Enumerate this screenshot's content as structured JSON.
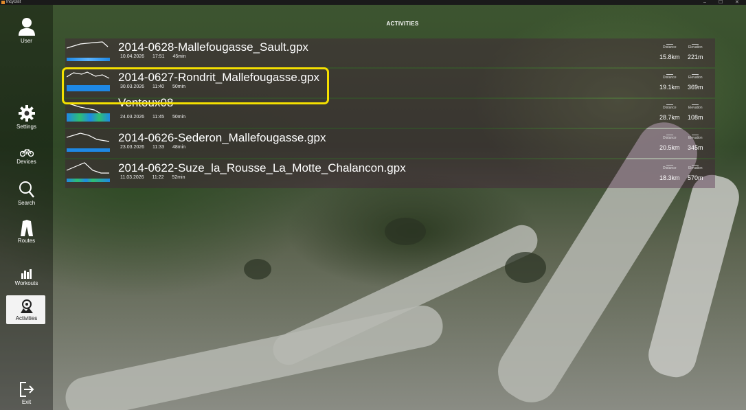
{
  "window": {
    "title": "Incyclist",
    "controls": [
      "–",
      "☐",
      "✕"
    ]
  },
  "header": {
    "title": "ACTIVITIES"
  },
  "sidebar": {
    "items": [
      {
        "label": "User",
        "icon": "user-icon"
      },
      {
        "label": "Settings",
        "icon": "gear-icon"
      },
      {
        "label": "Devices",
        "icon": "bike-icon"
      },
      {
        "label": "Search",
        "icon": "search-icon"
      },
      {
        "label": "Routes",
        "icon": "routes-icon"
      },
      {
        "label": "Workouts",
        "icon": "workouts-icon"
      },
      {
        "label": "Activities",
        "icon": "activities-icon",
        "active": true
      },
      {
        "label": "Exit",
        "icon": "exit-icon"
      }
    ]
  },
  "activities": {
    "distance_label": "Distance",
    "elevation_label": "Elevation",
    "items": [
      {
        "name": "2014-0628-Mallefougasse_Sault.gpx",
        "date": "10.04.2026",
        "time": "17:51",
        "duration": "45min",
        "distance": "15.8km",
        "elevation": "221m"
      },
      {
        "name": "2014-0627-Rondrit_Mallefougasse.gpx",
        "date": "30.03.2026",
        "time": "11:40",
        "duration": "50min",
        "distance": "19.1km",
        "elevation": "369m",
        "highlighted": true
      },
      {
        "name": "Ventoux08",
        "date": "24.03.2026",
        "time": "11:45",
        "duration": "50min",
        "distance": "28.7km",
        "elevation": "108m"
      },
      {
        "name": "2014-0626-Sederon_Mallefougasse.gpx",
        "date": "23.03.2026",
        "time": "11:33",
        "duration": "48min",
        "distance": "20.5km",
        "elevation": "345m"
      },
      {
        "name": "2014-0622-Suze_la_Rousse_La_Motte_Chalancon.gpx",
        "date": "11.03.2026",
        "time": "11:22",
        "duration": "52min",
        "distance": "18.3km",
        "elevation": "570m"
      }
    ]
  },
  "colors": {
    "accent_bar": "#1e88e5",
    "highlight": "#f5e000",
    "row_tint": "#46143c"
  }
}
